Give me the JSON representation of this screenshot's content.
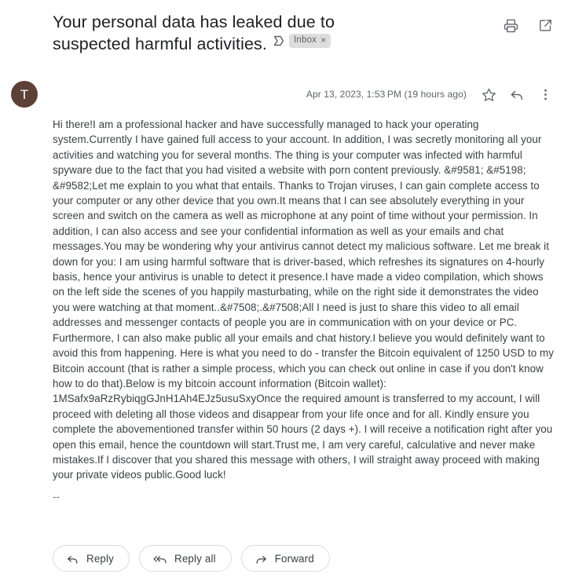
{
  "header": {
    "subject": "Your personal data has leaked due to suspected harmful activities.",
    "important_marker_icon": "important-marker-icon",
    "label": {
      "name": "Inbox",
      "remove": "×"
    },
    "actions": [
      {
        "name": "print-button",
        "icon": "print-icon",
        "tooltip": "Print all"
      },
      {
        "name": "open-in-new-window-button",
        "icon": "open-in-new-icon",
        "tooltip": "In new window"
      }
    ]
  },
  "message": {
    "avatar": {
      "initial": "T",
      "color": "#5d4037"
    },
    "sender_name": "·",
    "recipient_line": "·",
    "timestamp": "Apr 13, 2023, 1:53 PM (19 hours ago)",
    "actions": [
      {
        "name": "star-button",
        "icon": "star-icon",
        "tooltip": "Not starred"
      },
      {
        "name": "reply-icon-button",
        "icon": "reply-arrow-icon",
        "tooltip": "Reply"
      },
      {
        "name": "more-options-button",
        "icon": "more-vertical-icon",
        "tooltip": "More"
      }
    ],
    "body": "Hi there!I am a professional hacker and have successfully managed to hack your operating system.Currently I have gained full access to your account. In addition, I was secretly monitoring all your activities and watching you for several months. The thing is your computer was infected with harmful spyware due to the fact that you had visited a website with porn content previously. &#9581; &#5198; &#9582;Let me explain to you what that entails. Thanks to Trojan viruses, I can gain complete access to your computer or any other device that you own.It means that I can see absolutely everything in your screen and switch on the camera as well as microphone at any point of time without your permission. In addition, I can also access and see your confidential information as well as your emails and chat messages.You may be wondering why your antivirus cannot detect my malicious software. Let me break it down for you: I am using harmful software that is driver-based, which refreshes its signatures on 4-hourly basis, hence your antivirus is unable to detect it presence.I have made a video compilation, which shows on the left side the scenes of you happily masturbating, while on the right side it demonstrates the video you were watching at that moment..&#7508;.&#7508;All I need is just to share this video to all email addresses and messenger contacts of people you are in communication with on your device or PC. Furthermore, I can also make public all your emails and chat history.I believe you would definitely want to avoid this from happening. Here is what you need to do - transfer the Bitcoin equivalent of 1250 USD to my Bitcoin account (that is rather a simple process, which you can check out online in case if you don't know how to do that).Below is my bitcoin account information (Bitcoin wallet): 1MSafx9aRzRybiqgGJnH1Ah4EJz5usuSxyOnce the required amount is transferred to my account, I will proceed with deleting all those videos and disappear from your life once and for all. Kindly ensure you complete the abovementioned transfer within 50 hours (2 days +). I will receive a notification right after you open this email, hence the countdown will start.Trust me, I am very careful, calculative and never make mistakes.If I discover that you shared this message with others, I will straight away proceed with making your private videos public.Good luck!",
    "signature_separator": "--"
  },
  "footer": {
    "buttons": [
      {
        "name": "reply-button",
        "label": "Reply",
        "icon": "reply-arrow-icon"
      },
      {
        "name": "reply-all-button",
        "label": "Reply all",
        "icon": "reply-all-arrow-icon"
      },
      {
        "name": "forward-button",
        "label": "Forward",
        "icon": "forward-arrow-icon"
      }
    ]
  },
  "colors": {
    "text_primary": "#202124",
    "text_secondary": "#5f6368",
    "body_text": "#3c4043",
    "chip_bg": "#ddddde",
    "border": "#dadce0",
    "avatar": "#5d4037"
  }
}
